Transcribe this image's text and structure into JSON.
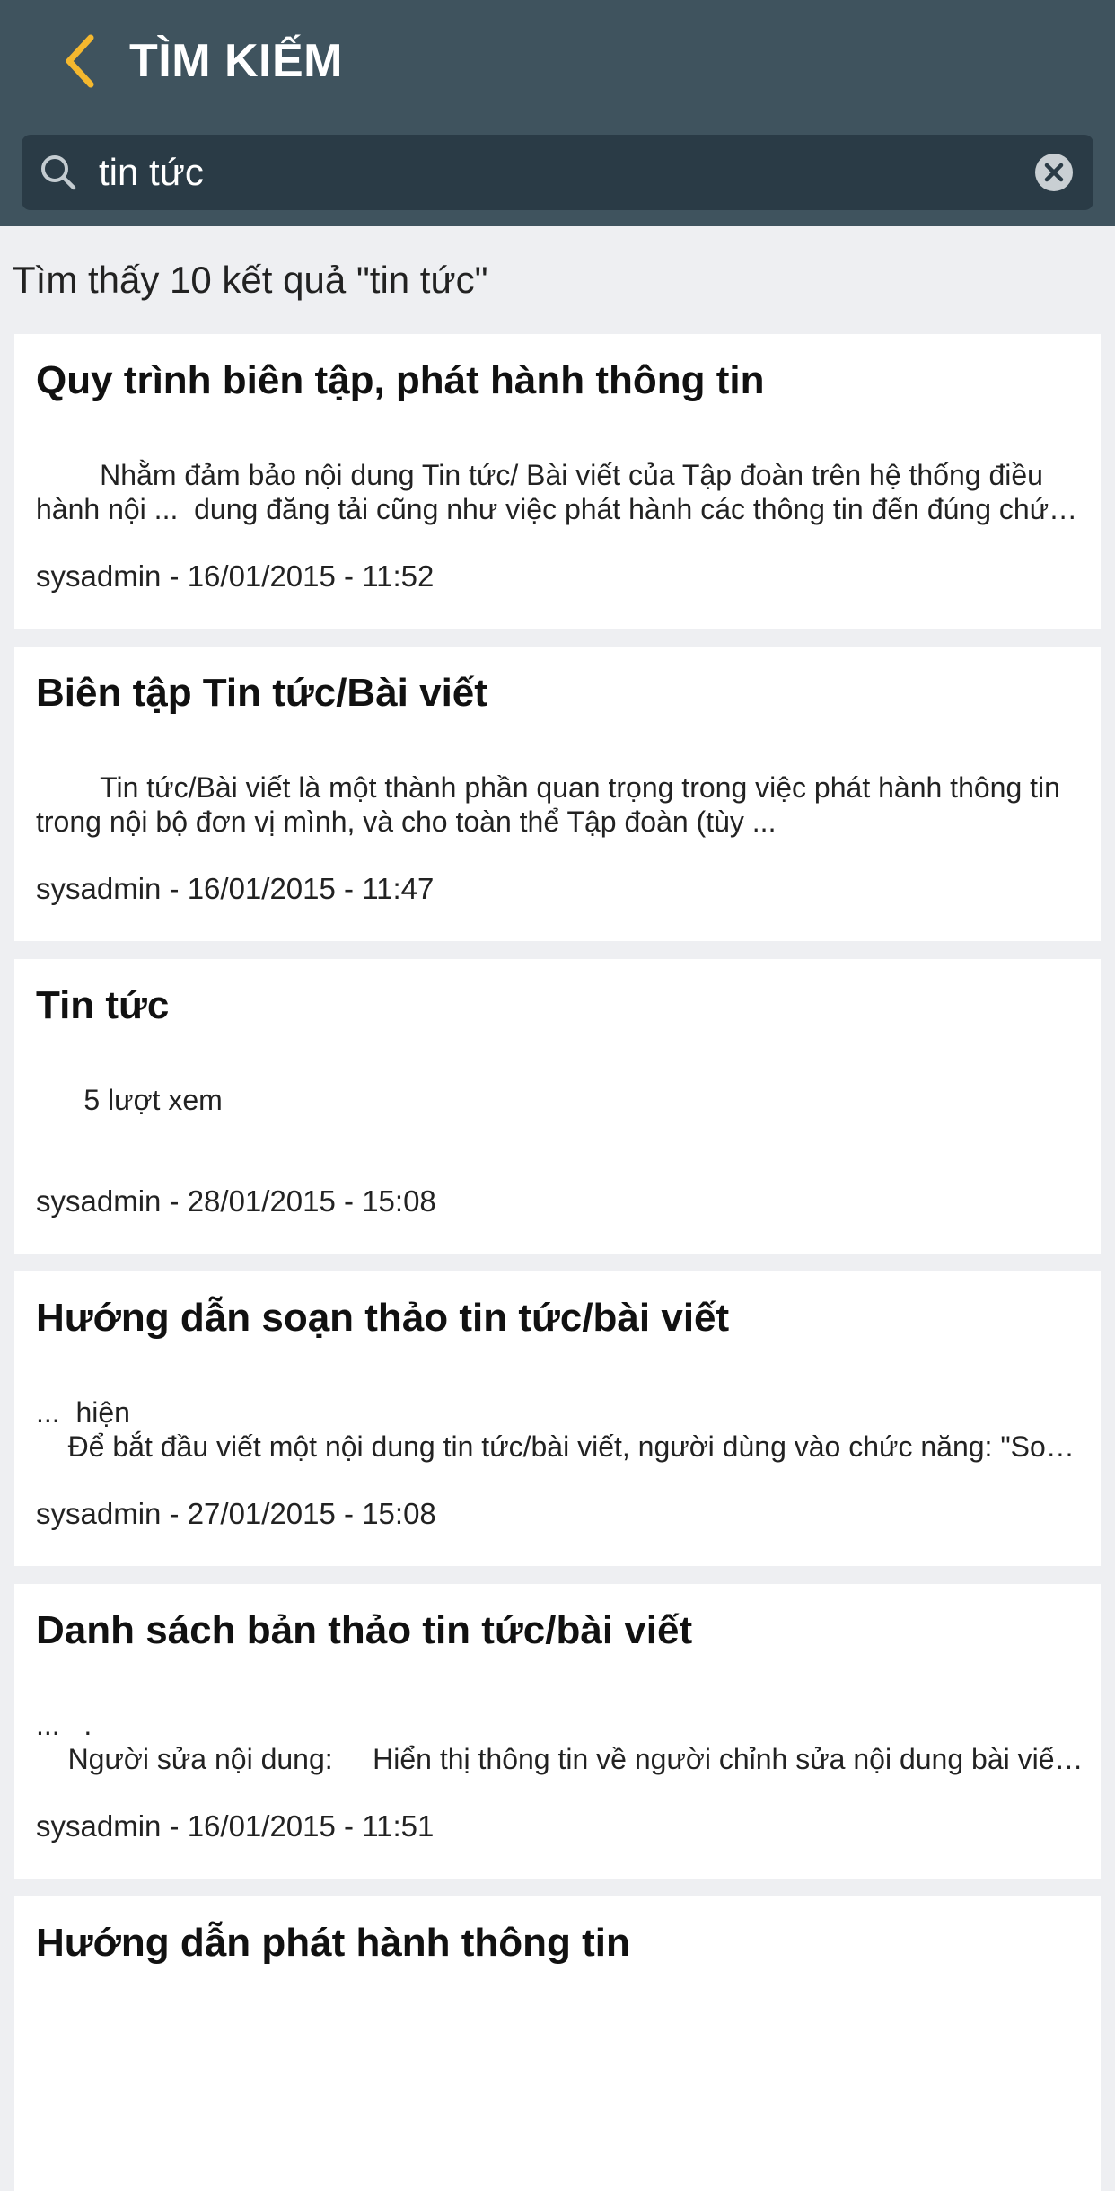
{
  "header": {
    "title": "TÌM KIẾM",
    "back_icon": "chevron-left-icon",
    "accent": "#f5b82e",
    "background": "#3f535e"
  },
  "search": {
    "value": "tin tức",
    "placeholder": "",
    "search_icon": "search-icon",
    "clear_icon": "clear-circle-icon"
  },
  "result_summary": "Tìm thấy 10 kết quả \"tin tức\"",
  "results": [
    {
      "title": "Quy trình biên tập, phát hành thông tin",
      "snippet": "        Nhằm đảm bảo nội dung Tin tức/ Bài viết của Tập đoàn trên hệ thống điều hành nội ...  dung đăng tải cũng như việc phát hành các thông tin đến đúng chức năng ...",
      "meta": "sysadmin - 16/01/2015 - 11:52"
    },
    {
      "title": "Biên tập Tin tức/Bài viết",
      "snippet": "        Tin tức/Bài viết là một thành phần quan trọng trong việc phát hành thông tin trong nội bộ đơn vị mình, và cho toàn thể Tập đoàn (tùy ...",
      "meta": "sysadmin - 16/01/2015 - 11:47"
    },
    {
      "title": "Tin tức",
      "snippet": "      5 lượt xem",
      "meta": "sysadmin - 28/01/2015 - 15:08"
    },
    {
      "title": "Hướng dẫn soạn thảo tin tức/bài viết",
      "snippet": "...  hiện\n    Để bắt đầu viết một nội dung tin tức/bài viết, người dùng vào chức năng: \"Soạn thảo ...",
      "meta": "sysadmin - 27/01/2015 - 15:08"
    },
    {
      "title": "Danh sách bản thảo tin tức/bài viết",
      "snippet": "...   .\n    Người sửa nội dung:     Hiển thị thông tin về người chỉnh sửa nội dung bài viết ...",
      "meta": "sysadmin - 16/01/2015 - 11:51"
    },
    {
      "title": "Hướng dẫn phát hành thông tin",
      "snippet": "",
      "meta": ""
    }
  ]
}
